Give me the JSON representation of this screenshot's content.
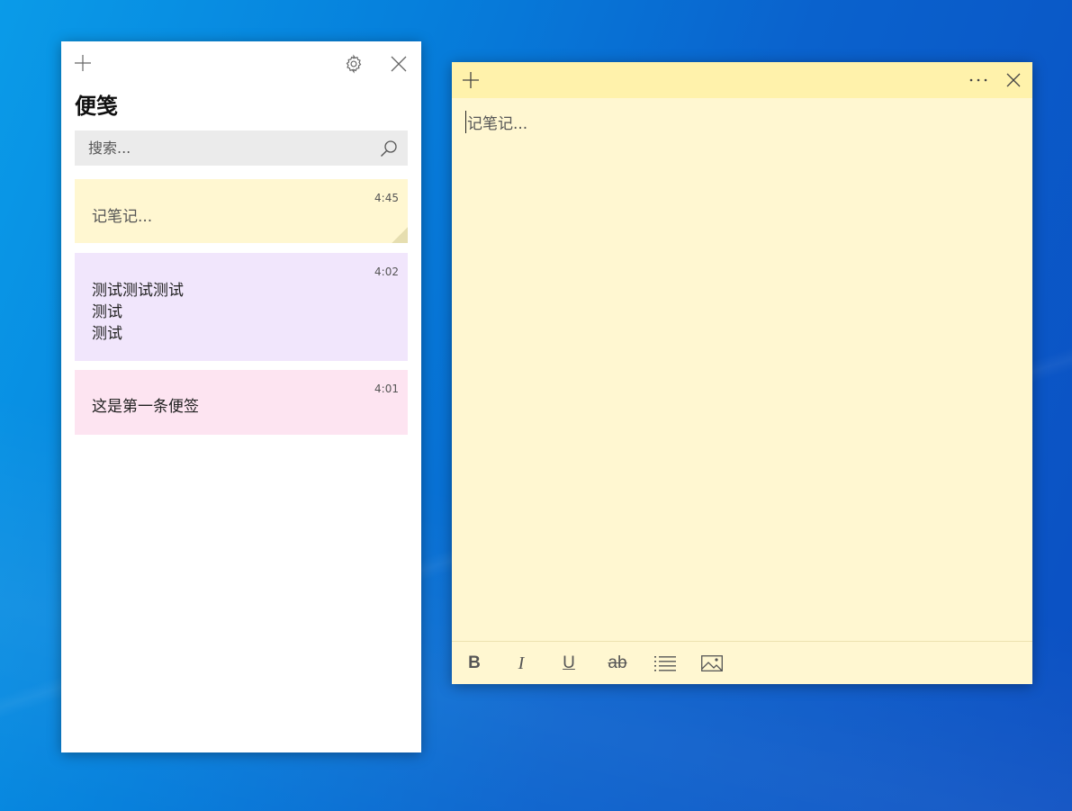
{
  "list_window": {
    "title": "便笺",
    "search_placeholder": "搜索...",
    "notes": [
      {
        "time": "4:45",
        "text": "记笔记...",
        "color": "#fff7d1"
      },
      {
        "time": "4:02",
        "text": "测试测试测试\n测试\n测试",
        "color": "#f1e6fc"
      },
      {
        "time": "4:01",
        "text": "这是第一条便签",
        "color": "#fde4f1"
      }
    ],
    "icons": {
      "new": "plus-icon",
      "settings": "gear-icon",
      "close": "close-icon",
      "search": "search-icon"
    }
  },
  "note_window": {
    "content_placeholder": "记笔记...",
    "header_color": "#fff2ab",
    "body_color": "#fff7d1",
    "toolbar": {
      "bold": "B",
      "italic": "I",
      "underline": "U",
      "strikethrough": "ab",
      "icons": [
        "bold-icon",
        "italic-icon",
        "underline-icon",
        "strikethrough-icon",
        "bulleted-list-icon",
        "image-icon"
      ]
    },
    "icons": {
      "new": "plus-icon",
      "menu": "more-icon",
      "close": "close-icon"
    }
  }
}
